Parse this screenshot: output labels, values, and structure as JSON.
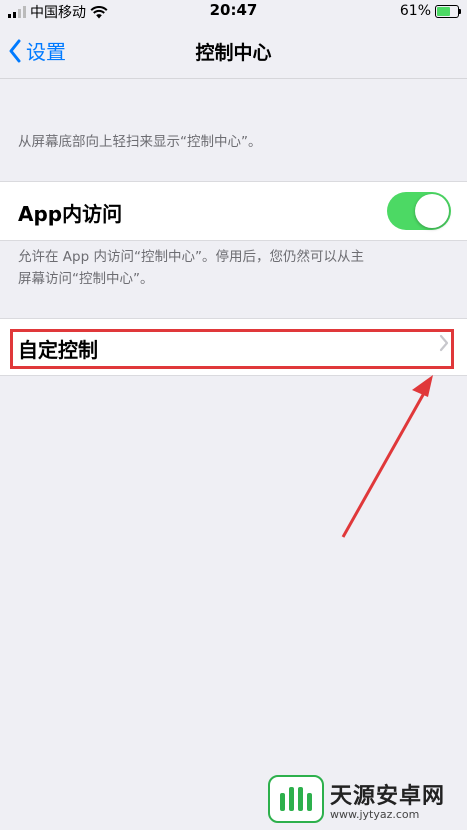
{
  "status_bar": {
    "carrier": "中国移动",
    "time": "20:47",
    "battery": "61%",
    "battery_level": 0.61
  },
  "nav": {
    "back_label": "设置",
    "title": "控制中心"
  },
  "section_intro": "从屏幕底部向上轻扫来显示“控制中心”。",
  "access_in_apps": {
    "label": "App内访问",
    "enabled": true,
    "footer_line1": "允许在 App 内访问“控制中心”。停用后，您仍然可以从主",
    "footer_line2": "屏幕访问“控制中心”。"
  },
  "customize": {
    "label": "自定控制"
  },
  "watermark": {
    "name": "天源安卓网",
    "url": "www.jytyaz.com"
  },
  "colors": {
    "accent": "#007aff",
    "toggle_on": "#4cd964",
    "highlight": "#e0383a"
  }
}
